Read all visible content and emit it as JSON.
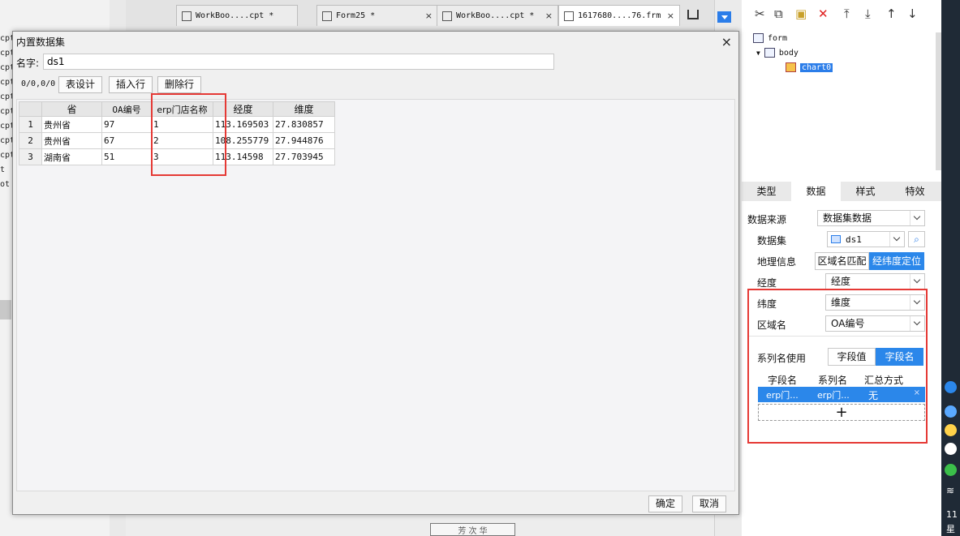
{
  "left_strip": {
    "items": [
      "cpt",
      "cpt",
      "cpt",
      "cpt",
      "cpt",
      "cpt",
      "cpt",
      "cpt",
      "cpt",
      "t",
      "ot"
    ]
  },
  "tabs": [
    {
      "label": "WorkBoo....cpt *",
      "close": "×"
    },
    {
      "label": "Form25 *",
      "close": "×"
    },
    {
      "label": "WorkBoo....cpt *",
      "close": "×"
    },
    {
      "label": "1617680....76.frm",
      "close": "×"
    }
  ],
  "canvas_text": "芳 次 华",
  "tree": {
    "nodes": [
      "form",
      "body",
      "chart0"
    ]
  },
  "prop_tabs": [
    "类型",
    "数据",
    "样式",
    "特效"
  ],
  "props": {
    "data_source_label": "数据来源",
    "data_source_value": "数据集数据",
    "dataset_label": "数据集",
    "dataset_value": "ds1",
    "geo_label": "地理信息",
    "geo_opt1": "区域名匹配",
    "geo_opt2": "经纬度定位",
    "lng_label": "经度",
    "lng_value": "经度",
    "lat_label": "纬度",
    "lat_value": "维度",
    "area_label": "区域名",
    "area_value": "OA编号",
    "series_label": "系列名使用",
    "series_opt1": "字段值",
    "series_opt2": "字段名",
    "col_field": "字段名",
    "col_series": "系列名",
    "col_summary": "汇总方式",
    "row_field": "erp门...",
    "row_series": "erp门...",
    "row_summary": "无",
    "add": "+"
  },
  "dialog": {
    "title": "内置数据集",
    "close": "×",
    "name_label": "名字:",
    "name_value": "ds1",
    "counter": "0/0,0/0",
    "btn_design": "表设计",
    "btn_insert": "插入行",
    "btn_delete": "删除行",
    "columns": [
      "省",
      "OA编号",
      "erp门店名称",
      "经度",
      "维度"
    ],
    "rows": [
      [
        "1",
        "贵州省",
        "97",
        "1",
        "113.169503",
        "27.830857"
      ],
      [
        "2",
        "贵州省",
        "67",
        "2",
        "108.255779",
        "27.944876"
      ],
      [
        "3",
        "湖南省",
        "51",
        "3",
        "113.14598",
        "27.703945"
      ]
    ],
    "ok": "确定",
    "cancel": "取消"
  },
  "tray_time": "11",
  "tray_day": "星"
}
